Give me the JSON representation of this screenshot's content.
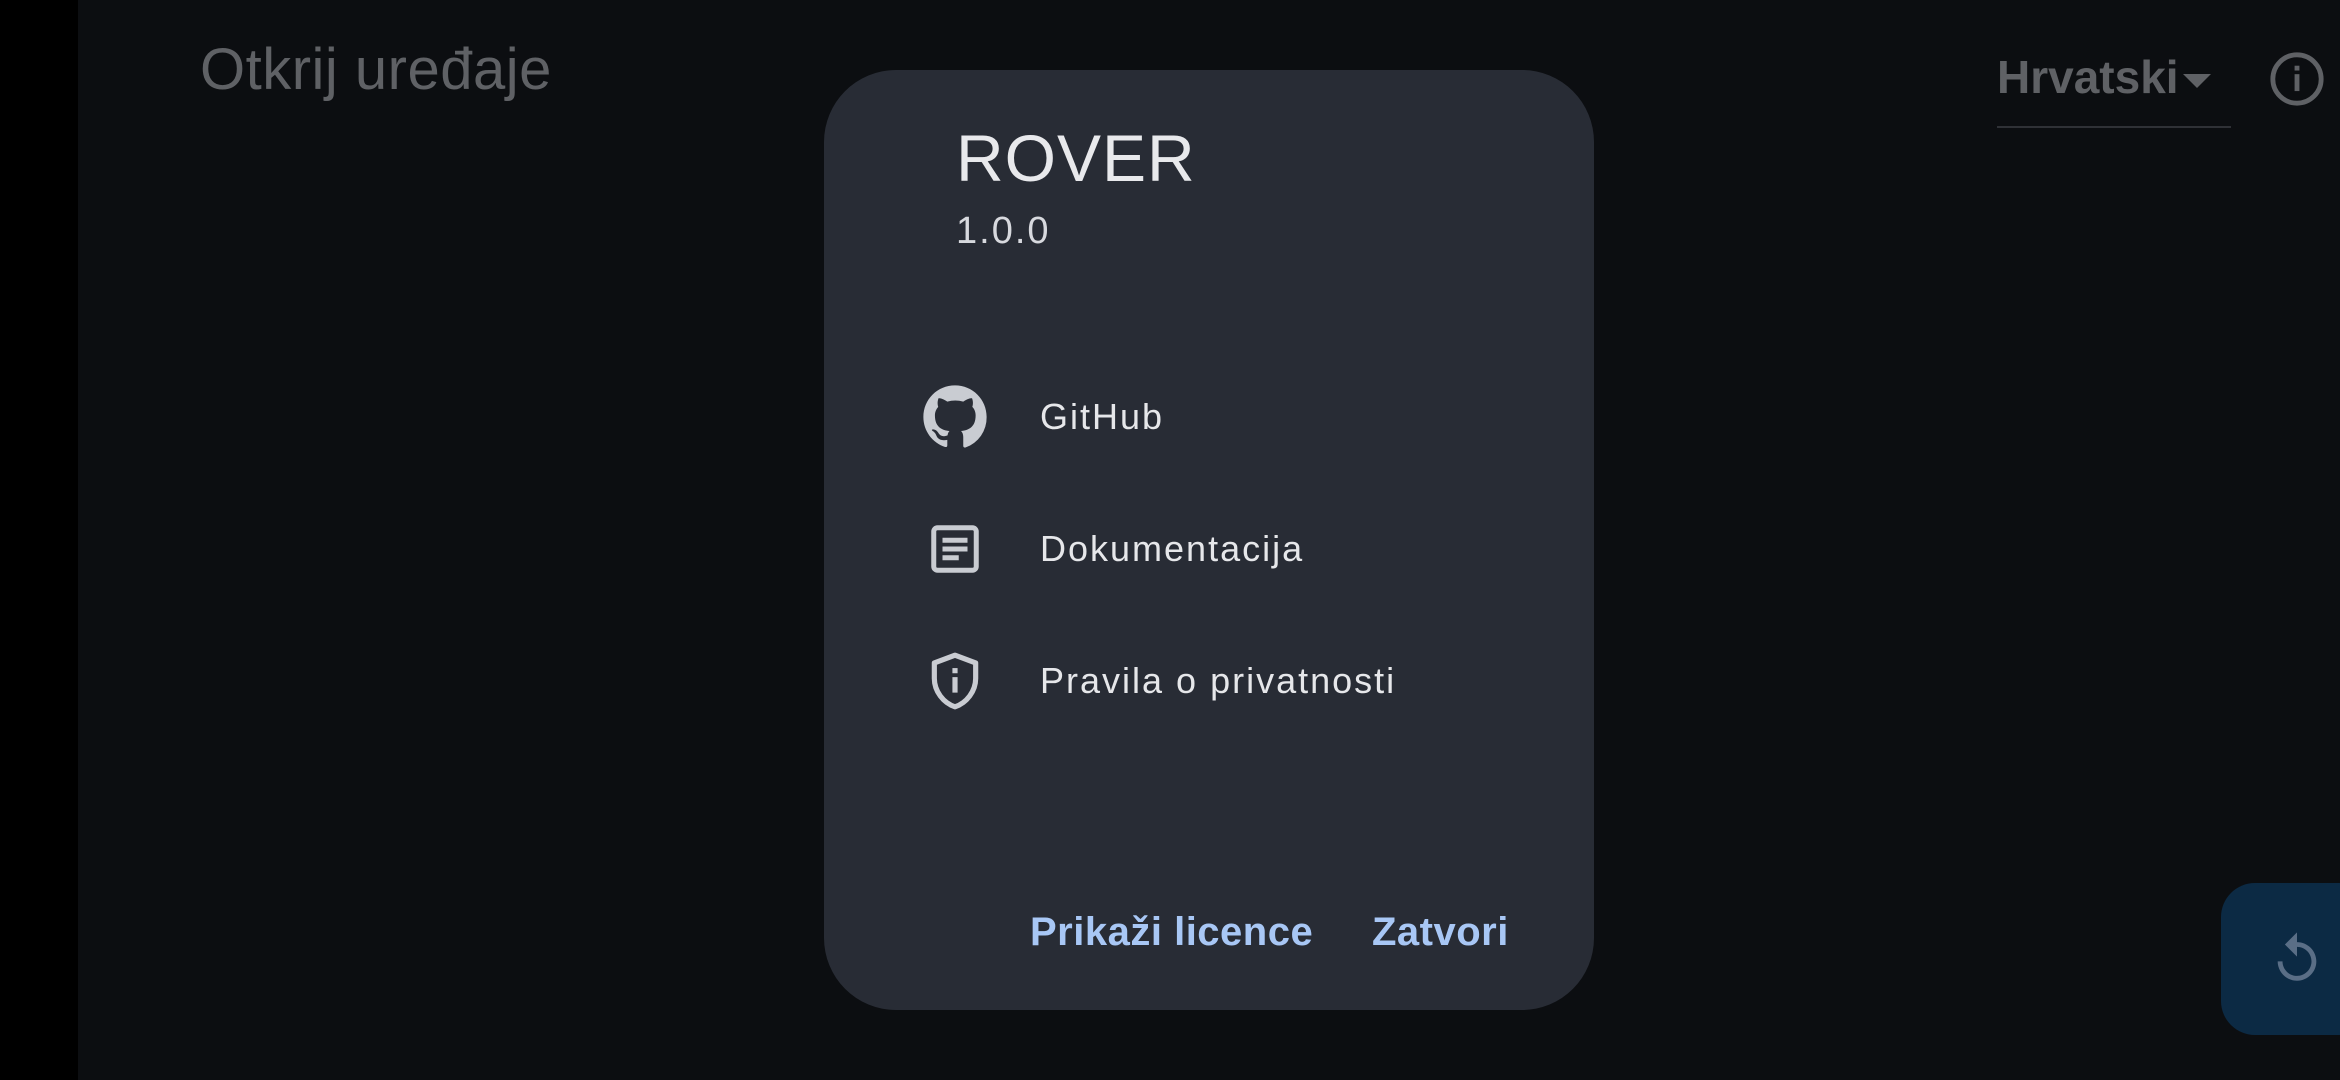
{
  "page": {
    "title": "Otkrij uređaje",
    "language": "Hrvatski",
    "info_icon": "info-circle-icon",
    "refresh_icon": "refresh-icon"
  },
  "dialog": {
    "app_name": "ROVER",
    "version": "1.0.0",
    "links": [
      {
        "icon": "github-icon",
        "label": "GitHub"
      },
      {
        "icon": "document-icon",
        "label": "Dokumentacija"
      },
      {
        "icon": "privacy-shield-icon",
        "label": "Pravila o privatnosti"
      }
    ],
    "actions": {
      "show_licenses": "Prikaži licence",
      "close": "Zatvori"
    }
  },
  "colors": {
    "background": "#0c0e11",
    "dialog": "#282c35",
    "accent": "#a8c7f5",
    "fab": "#0c2a44"
  }
}
